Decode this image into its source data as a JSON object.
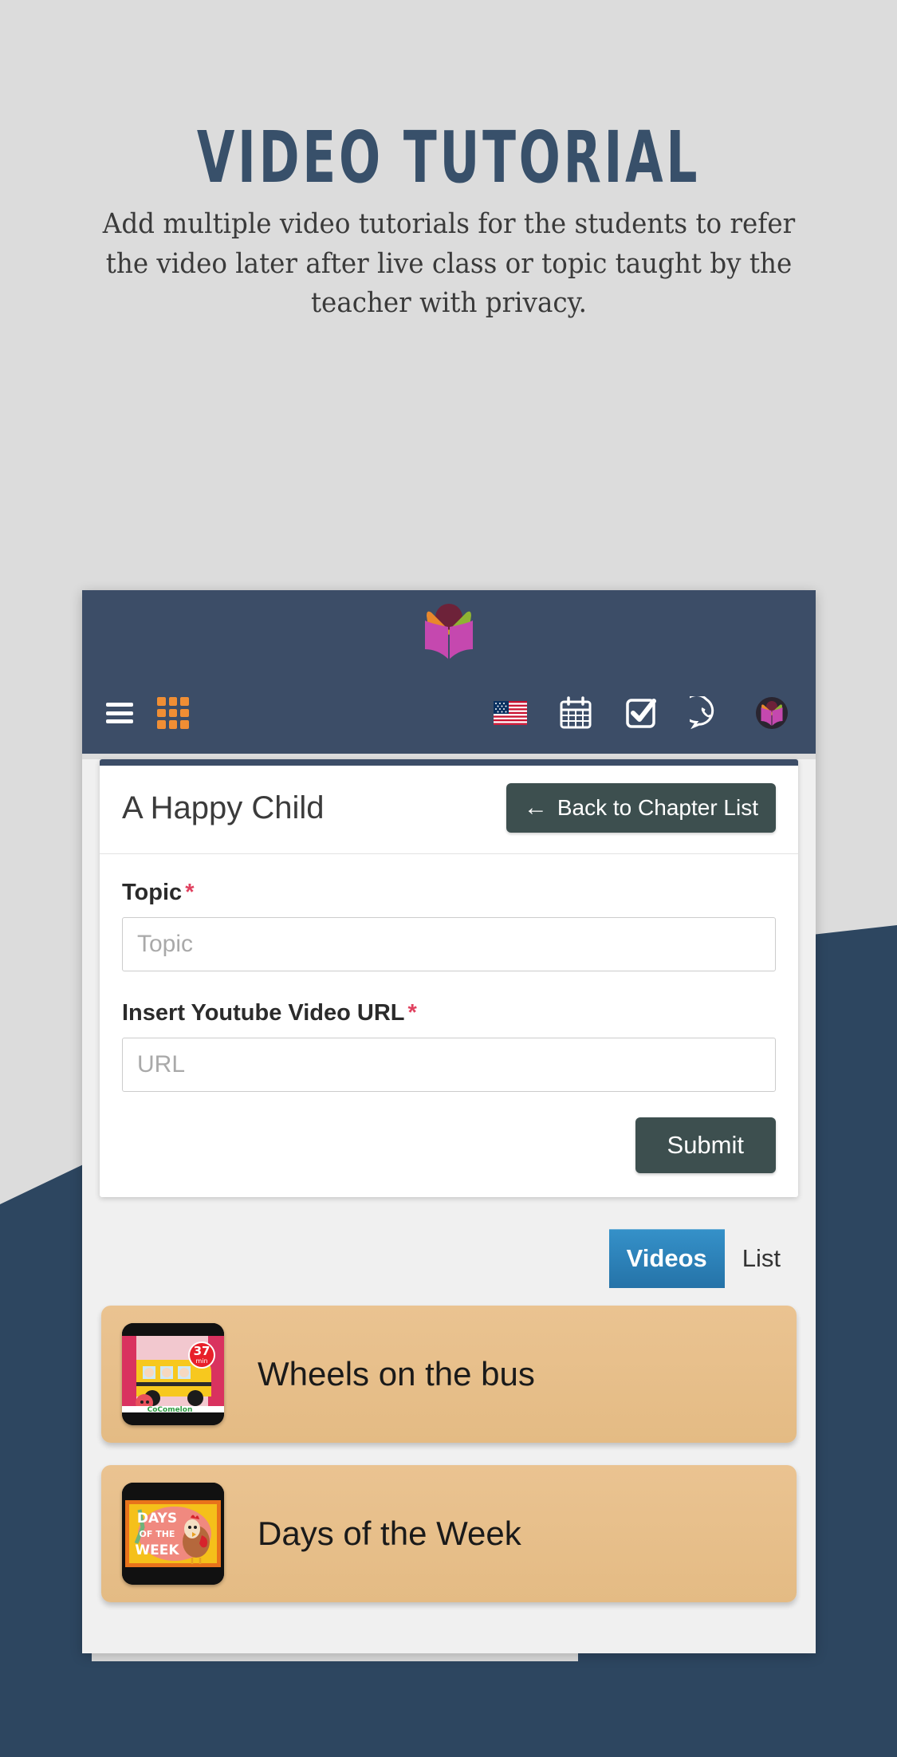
{
  "hero": {
    "title": "VIDEO  TUTORIAL",
    "subtitle": "Add multiple video tutorials for the students to refer the video later after live class or topic taught by the teacher with privacy."
  },
  "app": {
    "header": {
      "brand_logo_icon": "open-book-logo-icon",
      "left_icons": [
        {
          "name": "hamburger-menu-icon",
          "label": "Menu"
        },
        {
          "name": "apps-grid-icon",
          "label": "Apps"
        }
      ],
      "right_icons": [
        {
          "name": "us-flag-icon",
          "label": "Language"
        },
        {
          "name": "calendar-icon",
          "label": "Calendar"
        },
        {
          "name": "checkbox-checked-icon",
          "label": "Tasks"
        },
        {
          "name": "whatsapp-icon",
          "label": "WhatsApp"
        },
        {
          "name": "user-avatar-logo-icon",
          "label": "Profile"
        }
      ]
    },
    "card": {
      "chapter_title": "A Happy Child",
      "back_button": {
        "arrow": "←",
        "label": "Back to Chapter List"
      },
      "fields": [
        {
          "label": "Topic",
          "required_mark": "*",
          "placeholder": "Topic",
          "value": ""
        },
        {
          "label": "Insert Youtube Video URL",
          "required_mark": "*",
          "placeholder": "URL",
          "value": ""
        }
      ],
      "submit_label": "Submit"
    },
    "tabs": [
      {
        "label": "Videos",
        "active": true
      },
      {
        "label": "List",
        "active": false
      }
    ],
    "videos": [
      {
        "title": "Wheels on the bus",
        "thumb": "cocomelon-school-bus-thumbnail",
        "badge": "37 min"
      },
      {
        "title": "Days of the Week",
        "thumb": "days-of-the-week-chicken-thumbnail",
        "badge": ""
      }
    ]
  },
  "colors": {
    "page_background": "#dcdcdc",
    "navy_shape": "#2d4660",
    "app_header": "#3c4d67",
    "app_body": "#f0f0f0",
    "button_dark": "#3d4f4f",
    "tab_active": "#2d82bd",
    "video_row": "#e6bf89",
    "accent_orange": "#f08e34",
    "required_red": "#e0415f",
    "title_navy": "#38506a"
  }
}
